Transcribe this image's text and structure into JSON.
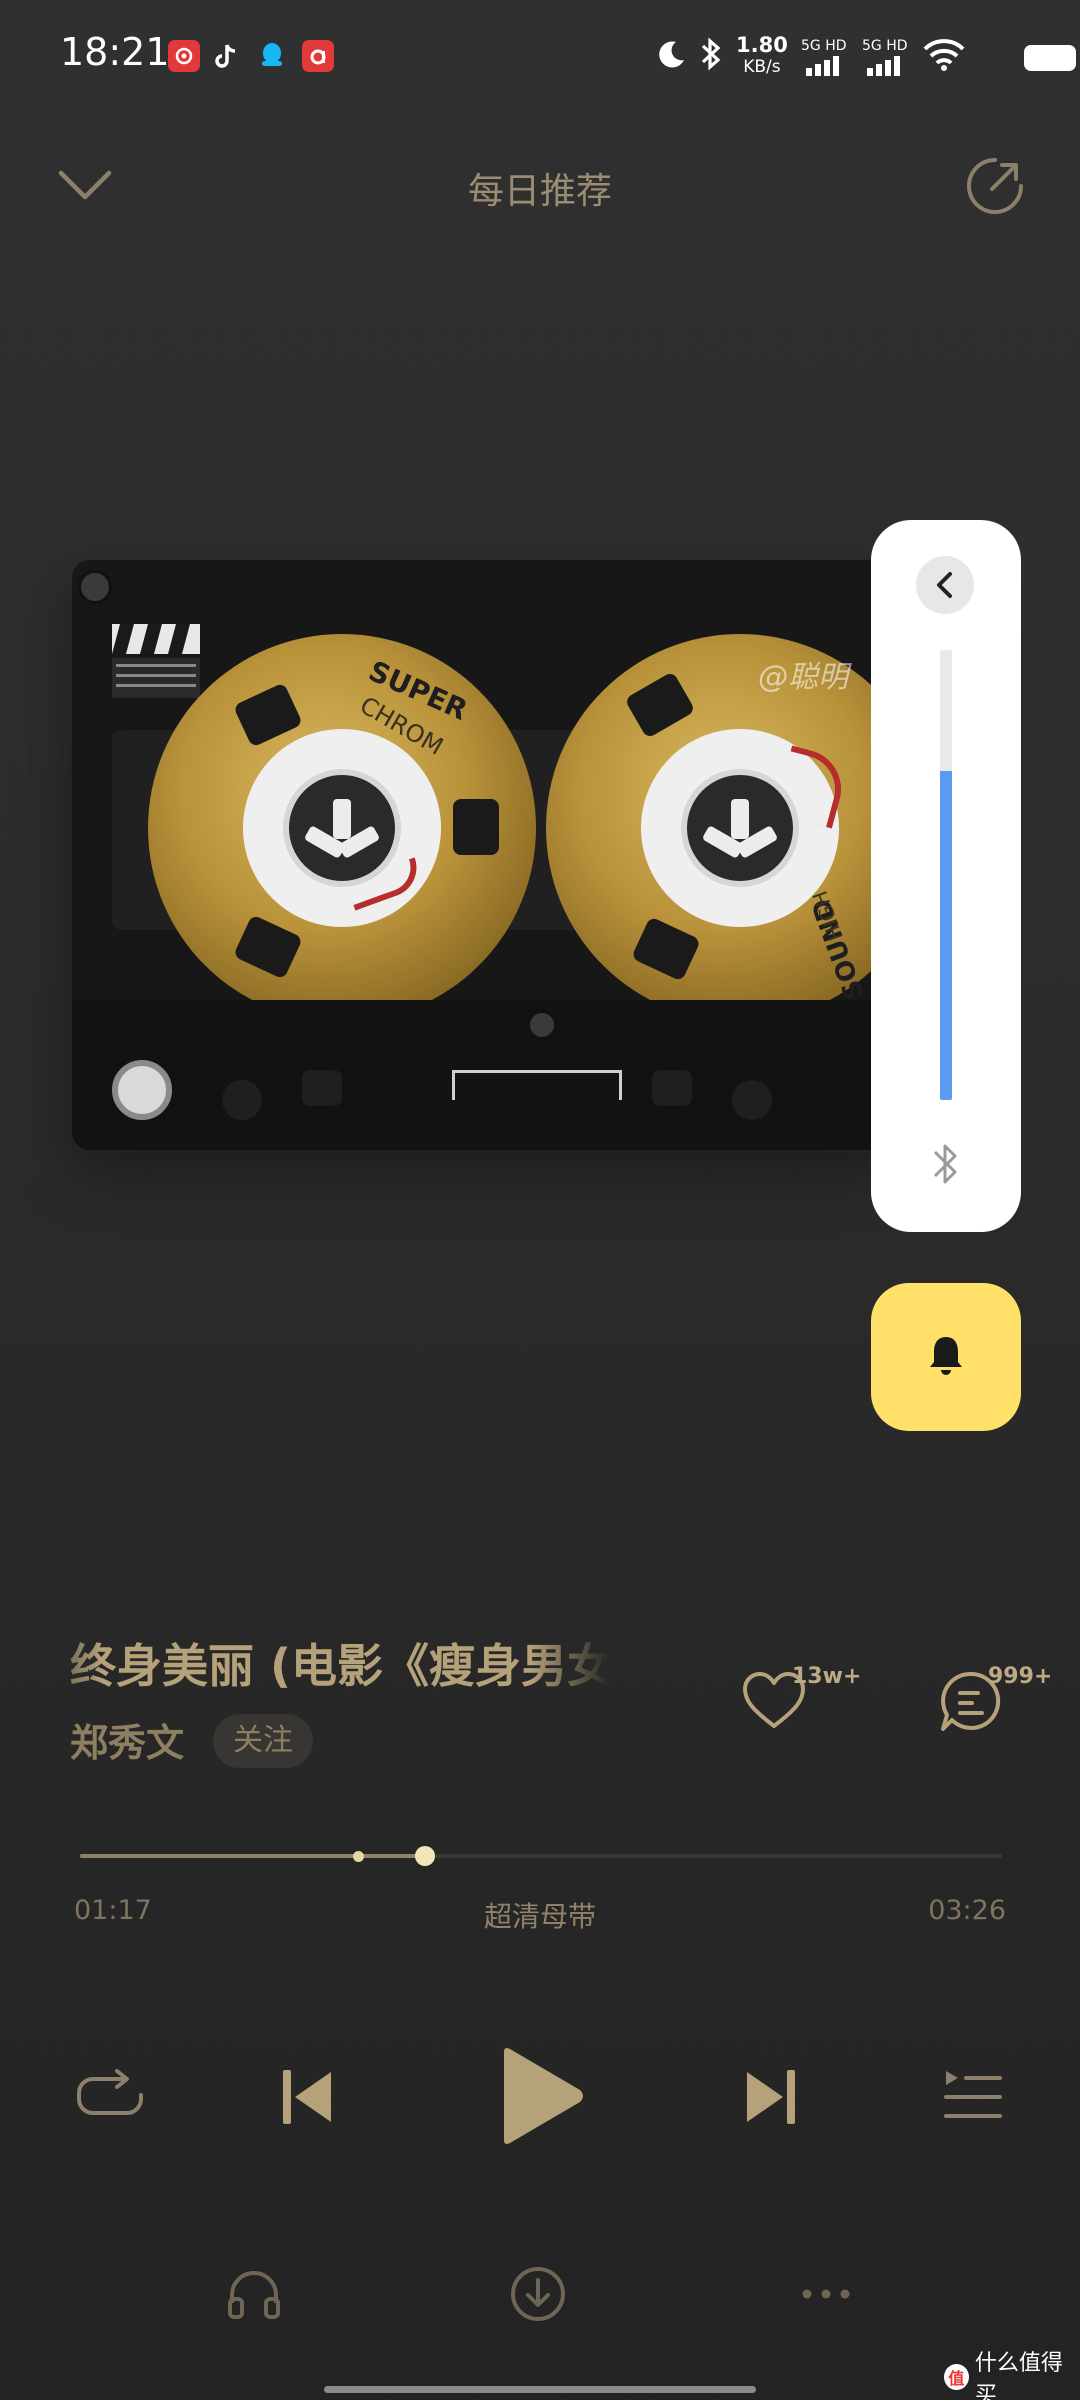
{
  "status_bar": {
    "time": "18:21",
    "apps": [
      {
        "icon": "netease-music-icon",
        "color": "#e23a3a"
      },
      {
        "icon": "tiktok-icon",
        "color": "#ffffff"
      },
      {
        "icon": "qq-icon",
        "color": "#19b6f5"
      },
      {
        "icon": "acfun-icon",
        "color": "#e23a3a"
      }
    ],
    "net_speed_value": "1.80",
    "net_speed_unit": "KB/s",
    "sim_label_1": "5G HD",
    "sim_label_2": "5G HD",
    "icons": [
      "moon-icon",
      "bluetooth-icon",
      "signal-icon",
      "wifi-icon",
      "battery-icon"
    ]
  },
  "header": {
    "title": "每日推荐",
    "left_icon": "chevron-down-icon",
    "right_icon": "share-icon"
  },
  "cassette": {
    "left_reel_text_1": "SUPER",
    "left_reel_text_2": "CHROM",
    "right_reel_text_1": "SOUND",
    "right_reel_text_2": "HIGH",
    "watermark": "@聪明"
  },
  "volume_panel": {
    "level": 0.73,
    "fill_color": "#5a9bf0",
    "back_icon": "chevron-left-icon",
    "device_icon": "bluetooth-icon"
  },
  "ring_button": {
    "icon": "bell-icon",
    "color": "#ffe16a"
  },
  "song": {
    "title": "终身美丽 (电影《瘦身男女》主题曲)",
    "artist": "郑秀文",
    "follow_label": "关注",
    "likes": "13w+",
    "comments": "999+"
  },
  "progress": {
    "current": "01:17",
    "total": "03:26",
    "played_fraction": 0.374,
    "buffer_fraction": 0.302,
    "quality": "超清母带"
  },
  "controls": [
    "repeat-icon",
    "previous-icon",
    "play-icon",
    "next-icon",
    "playlist-icon"
  ],
  "bottom_bar": [
    "headphones-icon",
    "download-icon",
    "more-icon"
  ],
  "watermark": {
    "badge": "值",
    "text": "什么值得买"
  }
}
